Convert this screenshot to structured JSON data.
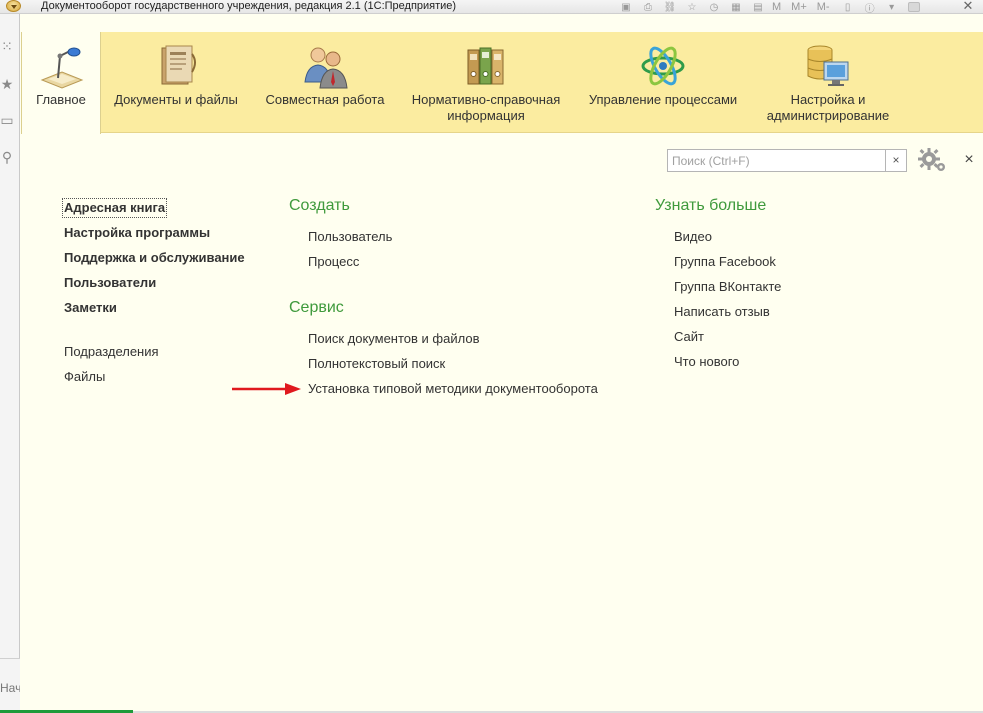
{
  "window": {
    "title": "Документооборот государственного учреждения, редакция 2.1  (1С:Предприятие)",
    "toolbar_text": [
      "M",
      "M+",
      "M-"
    ]
  },
  "left_strip": {
    "bottom_label": "Нач"
  },
  "sections": [
    {
      "label": "Главное",
      "icon": "desk-lamp-icon",
      "active": true
    },
    {
      "label": "Документы и файлы",
      "icon": "document-folder-icon",
      "active": false
    },
    {
      "label": "Совместная работа",
      "icon": "people-icon",
      "active": false
    },
    {
      "label": "Нормативно-справочная\nинформация",
      "icon": "binders-icon",
      "active": false
    },
    {
      "label": "Управление процессами",
      "icon": "atom-icon",
      "active": false
    },
    {
      "label": "Настройка и\nадминистрирование",
      "icon": "database-monitor-icon",
      "active": false
    }
  ],
  "search": {
    "placeholder": "Поиск (Ctrl+F)",
    "value": "",
    "clear_label": "×"
  },
  "panel_close_label": "×",
  "nav_left": {
    "primary": [
      "Адресная книга",
      "Настройка программы",
      "Поддержка и обслуживание",
      "Пользователи",
      "Заметки"
    ],
    "secondary": [
      "Подразделения",
      "Файлы"
    ]
  },
  "groups": {
    "create": {
      "title": "Создать",
      "items": [
        "Пользователь",
        "Процесс"
      ]
    },
    "service": {
      "title": "Сервис",
      "items": [
        "Поиск документов и файлов",
        "Полнотекстовый поиск",
        "Установка типовой методики документооборота"
      ]
    },
    "learn_more": {
      "title": "Узнать больше",
      "items": [
        "Видео",
        "Группа Facebook",
        "Группа ВКонтакте",
        "Написать отзыв",
        "Сайт",
        "Что нового"
      ]
    }
  },
  "colors": {
    "section_bar": "#fbeca0",
    "content_bg": "#fffff0",
    "group_title": "#3f9a3c",
    "annotation_arrow": "#e0191e"
  }
}
